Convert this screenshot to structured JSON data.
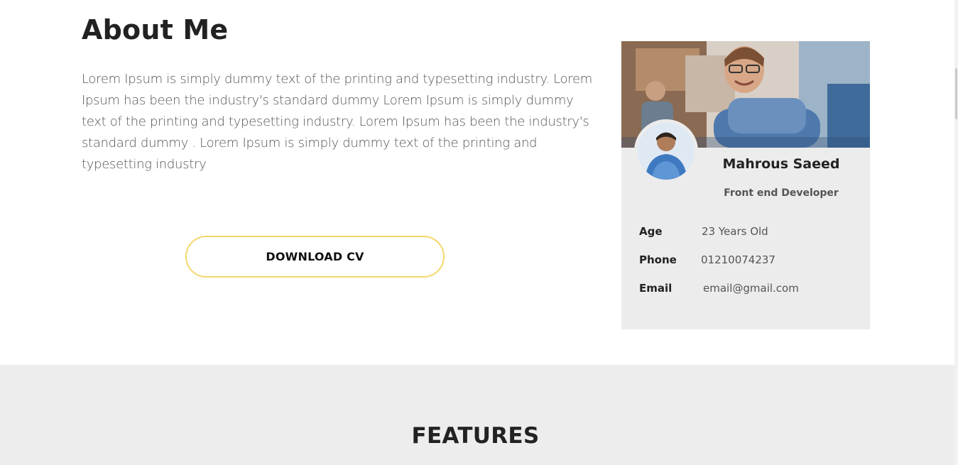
{
  "about": {
    "title": "About Me",
    "text": "Lorem Ipsum is simply dummy text of the printing and typesetting industry. Lorem Ipsum has been the industry's standard dummy Lorem Ipsum is simply dummy text of the printing and typesetting industry. Lorem Ipsum has been the industry's standard dummy . Lorem Ipsum is simply dummy text of the printing and typesetting industry",
    "download_label": "DOWNLOAD CV"
  },
  "profile": {
    "name": "Mahrous Saeed",
    "role": "Front end Developer",
    "info": [
      {
        "label": "Age",
        "value": "23 Years Old"
      },
      {
        "label": "Phone",
        "value": "01210074237"
      },
      {
        "label": "Email",
        "value": "email@gmail.com"
      }
    ]
  },
  "features": {
    "title": "FEATURES"
  },
  "colors": {
    "accent_border": "#f5d76e",
    "card_bg": "#ececec",
    "section_bg": "#ededed"
  }
}
